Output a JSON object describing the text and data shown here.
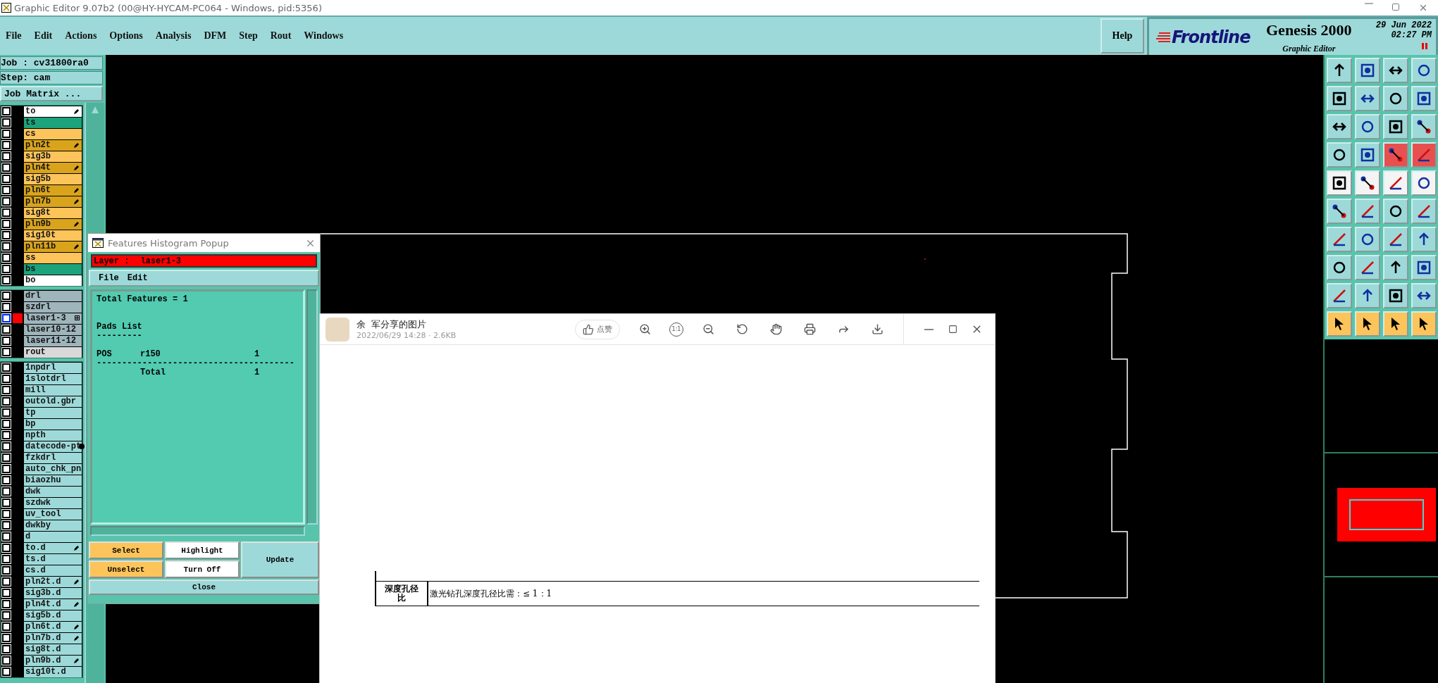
{
  "window": {
    "title": "Graphic Editor 9.07b2 (00@HY-HYCAM-PC064 - Windows, pid:5356)"
  },
  "menu": [
    "File",
    "Edit",
    "Actions",
    "Options",
    "Analysis",
    "DFM",
    "Step",
    "Rout",
    "Windows"
  ],
  "help": "Help",
  "brand": {
    "logo": "Frontline",
    "product": "Genesis 2000",
    "module": "Graphic Editor",
    "date": "29 Jun 2022",
    "time": "02:27 PM"
  },
  "job": {
    "job": "Job : cv31800ra0",
    "step": "Step: cam",
    "matrix_button": "Job Matrix ..."
  },
  "layer_groups": [
    {
      "layers": [
        {
          "name": "to",
          "color": "#ffffff",
          "kind": "pencil",
          "checked": false,
          "selected": false
        },
        {
          "name": "ts",
          "color": "#1ca37c",
          "kind": "plain",
          "checked": false,
          "selected": false
        },
        {
          "name": "cs",
          "color": "#fcc45a",
          "kind": "plain",
          "checked": false,
          "selected": false
        },
        {
          "name": "pln2t",
          "color": "#d9a41c",
          "kind": "pencil",
          "checked": false,
          "selected": false
        },
        {
          "name": "sig3b",
          "color": "#fcc45a",
          "kind": "plain",
          "checked": false,
          "selected": false
        },
        {
          "name": "pln4t",
          "color": "#d9a41c",
          "kind": "pencil",
          "checked": false,
          "selected": false
        },
        {
          "name": "sig5b",
          "color": "#fcc45a",
          "kind": "plain",
          "checked": false,
          "selected": false
        },
        {
          "name": "pln6t",
          "color": "#d9a41c",
          "kind": "pencil",
          "checked": false,
          "selected": false
        },
        {
          "name": "pln7b",
          "color": "#d9a41c",
          "kind": "pencil",
          "checked": false,
          "selected": false
        },
        {
          "name": "sig8t",
          "color": "#fcc45a",
          "kind": "plain",
          "checked": false,
          "selected": false
        },
        {
          "name": "pln9b",
          "color": "#d9a41c",
          "kind": "pencil",
          "checked": false,
          "selected": false
        },
        {
          "name": "sig10t",
          "color": "#fcc45a",
          "kind": "plain",
          "checked": false,
          "selected": false
        },
        {
          "name": "pln11b",
          "color": "#d9a41c",
          "kind": "pencil",
          "checked": false,
          "selected": false
        },
        {
          "name": "ss",
          "color": "#fcc45a",
          "kind": "plain",
          "checked": false,
          "selected": false
        },
        {
          "name": "bs",
          "color": "#1ca37c",
          "kind": "plain",
          "checked": false,
          "selected": false
        },
        {
          "name": "bo",
          "color": "#ffffff",
          "kind": "plain",
          "checked": false,
          "selected": false
        }
      ]
    },
    {
      "layers": [
        {
          "name": "drl",
          "color": "#9fb5bc",
          "kind": "plain",
          "checked": false,
          "selected": false
        },
        {
          "name": "szdrl",
          "color": "#9fb5bc",
          "kind": "plain",
          "checked": false,
          "selected": false
        },
        {
          "name": "laser1-3",
          "color": "#9fb5bc",
          "kind": "grid",
          "checked": false,
          "selected": true
        },
        {
          "name": "laser10-12",
          "color": "#9fb5bc",
          "kind": "plain",
          "checked": false,
          "selected": false
        },
        {
          "name": "laser11-12",
          "color": "#9fb5bc",
          "kind": "plain",
          "checked": false,
          "selected": false
        },
        {
          "name": "rout",
          "color": "#d9d9d9",
          "kind": "plain",
          "checked": false,
          "selected": false
        }
      ]
    },
    {
      "layers": [
        {
          "name": "1npdrl",
          "color": "#9ed9d9",
          "kind": "plain",
          "checked": false,
          "selected": false
        },
        {
          "name": "1slotdrl",
          "color": "#9ed9d9",
          "kind": "plain",
          "checked": false,
          "selected": false
        },
        {
          "name": "mill",
          "color": "#9ed9d9",
          "kind": "plain",
          "checked": false,
          "selected": false
        },
        {
          "name": "outold.gbr",
          "color": "#9ed9d9",
          "kind": "plain",
          "checked": false,
          "selected": false
        },
        {
          "name": "tp",
          "color": "#9ed9d9",
          "kind": "plain",
          "checked": false,
          "selected": false
        },
        {
          "name": "bp",
          "color": "#9ed9d9",
          "kind": "plain",
          "checked": false,
          "selected": false
        },
        {
          "name": "npth",
          "color": "#9ed9d9",
          "kind": "plain",
          "checked": false,
          "selected": false
        },
        {
          "name": "datecode-pt",
          "color": "#9ed9d9",
          "kind": "dot",
          "checked": false,
          "selected": false
        },
        {
          "name": "fzkdrl",
          "color": "#9ed9d9",
          "kind": "plain",
          "checked": false,
          "selected": false
        },
        {
          "name": "auto_chk_pn",
          "color": "#9ed9d9",
          "kind": "plain",
          "checked": false,
          "selected": false
        },
        {
          "name": "biaozhu",
          "color": "#9ed9d9",
          "kind": "plain",
          "checked": false,
          "selected": false
        },
        {
          "name": "dwk",
          "color": "#9ed9d9",
          "kind": "plain",
          "checked": false,
          "selected": false
        },
        {
          "name": "szdwk",
          "color": "#9ed9d9",
          "kind": "plain",
          "checked": false,
          "selected": false
        },
        {
          "name": "uv_tool",
          "color": "#9ed9d9",
          "kind": "plain",
          "checked": false,
          "selected": false
        },
        {
          "name": "dwkby",
          "color": "#9ed9d9",
          "kind": "plain",
          "checked": false,
          "selected": false
        },
        {
          "name": "d",
          "color": "#9ed9d9",
          "kind": "plain",
          "checked": false,
          "selected": false
        },
        {
          "name": "to.d",
          "color": "#9ed9d9",
          "kind": "pencil",
          "checked": false,
          "selected": false
        },
        {
          "name": "ts.d",
          "color": "#9ed9d9",
          "kind": "plain",
          "checked": false,
          "selected": false
        },
        {
          "name": "cs.d",
          "color": "#9ed9d9",
          "kind": "plain",
          "checked": false,
          "selected": false
        },
        {
          "name": "pln2t.d",
          "color": "#9ed9d9",
          "kind": "pencil",
          "checked": false,
          "selected": false
        },
        {
          "name": "sig3b.d",
          "color": "#9ed9d9",
          "kind": "plain",
          "checked": false,
          "selected": false
        },
        {
          "name": "pln4t.d",
          "color": "#9ed9d9",
          "kind": "pencil",
          "checked": false,
          "selected": false
        },
        {
          "name": "sig5b.d",
          "color": "#9ed9d9",
          "kind": "plain",
          "checked": false,
          "selected": false
        },
        {
          "name": "pln6t.d",
          "color": "#9ed9d9",
          "kind": "pencil",
          "checked": false,
          "selected": false
        },
        {
          "name": "pln7b.d",
          "color": "#9ed9d9",
          "kind": "pencil",
          "checked": false,
          "selected": false
        },
        {
          "name": "sig8t.d",
          "color": "#9ed9d9",
          "kind": "plain",
          "checked": false,
          "selected": false
        },
        {
          "name": "pln9b.d",
          "color": "#9ed9d9",
          "kind": "pencil",
          "checked": false,
          "selected": false
        },
        {
          "name": "sig10t.d",
          "color": "#9ed9d9",
          "kind": "plain",
          "checked": false,
          "selected": false
        }
      ]
    }
  ],
  "histogram_popup": {
    "title": "Features Histogram Popup",
    "layer_label": "Layer :",
    "layer": "laser1-3",
    "menu": [
      "File",
      "Edit"
    ],
    "total_features": "Total Features = 1",
    "list_heading": "Pads List",
    "heading_rule": "---------",
    "rows": [
      {
        "polarity": "POS",
        "symbol": "r150",
        "count": "1"
      }
    ],
    "rule": "---------------------------------------",
    "total": {
      "label": "Total",
      "count": "1"
    },
    "buttons": {
      "select": "Select",
      "highlight": "Highlight",
      "update": "Update",
      "unselect": "Unselect",
      "turn_off": "Turn Off",
      "close": "Close"
    }
  },
  "image_viewer": {
    "title": "余  军分享的图片",
    "meta": "2022/06/29 14:28 · 2.6KB",
    "like": "点赞",
    "actual_size": "1:1",
    "document": {
      "label": "深度孔径比",
      "text": "激光钻孔深度孔径比需：≤ 1：1"
    }
  }
}
